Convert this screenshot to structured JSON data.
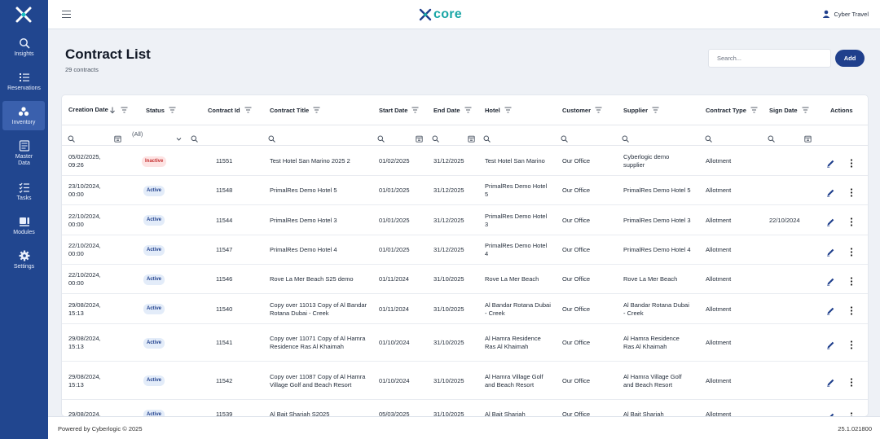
{
  "app": {
    "brand": "core",
    "user_name": "Cyber Travel"
  },
  "colors": {
    "sidebar": "#21468f",
    "sidebar_active": "#3a60ad",
    "accent": "#1f3f8c",
    "brand": "#19a6a6",
    "inactive": "#c53030"
  },
  "sidebar": {
    "items": [
      {
        "label": "Insights",
        "icon": "insights-icon"
      },
      {
        "label": "Reservations",
        "icon": "list-icon"
      },
      {
        "label": "Inventory",
        "icon": "inventory-icon",
        "active": true
      },
      {
        "label": "Master\nData",
        "icon": "master-data-icon"
      },
      {
        "label": "Tasks",
        "icon": "tasks-icon"
      },
      {
        "label": "Modules",
        "icon": "modules-icon"
      },
      {
        "label": "Settings",
        "icon": "gear-icon"
      }
    ]
  },
  "page": {
    "title": "Contract List",
    "count": "29 contracts",
    "search_placeholder": "Search...",
    "add_label": "Add"
  },
  "table": {
    "headers": {
      "creation_date": "Creation Date",
      "status": "Status",
      "contract_id": "Contract Id",
      "contract_title": "Contract Title",
      "start_date": "Start Date",
      "end_date": "End Date",
      "hotel": "Hotel",
      "customer": "Customer",
      "supplier": "Supplier",
      "contract_type": "Contract Type",
      "sign_date": "Sign Date",
      "actions": "Actions"
    },
    "status_filter": "(All)",
    "rows": [
      {
        "creation": "05/02/2025, 09:26",
        "status": "Inactive",
        "id": "11551",
        "title": "Test Hotel San Marino 2025 2",
        "start": "01/02/2025",
        "end": "31/12/2025",
        "hotel": "Test Hotel San Marino",
        "customer": "Our Office",
        "supplier": "Cyberlogic demo supplier",
        "type": "Allotment",
        "sign": ""
      },
      {
        "creation": "23/10/2024, 00:00",
        "status": "Active",
        "id": "11548",
        "title": "PrimalRes Demo Hotel 5",
        "start": "01/01/2025",
        "end": "31/12/2025",
        "hotel": "PrimalRes Demo Hotel 5",
        "customer": "Our Office",
        "supplier": "PrimalRes Demo Hotel 5",
        "type": "Allotment",
        "sign": ""
      },
      {
        "creation": "22/10/2024, 00:00",
        "status": "Active",
        "id": "11544",
        "title": "PrimalRes Demo Hotel 3",
        "start": "01/01/2025",
        "end": "31/12/2025",
        "hotel": "PrimalRes Demo Hotel 3",
        "customer": "Our Office",
        "supplier": "PrimalRes Demo Hotel 3",
        "type": "Allotment",
        "sign": "22/10/2024"
      },
      {
        "creation": "22/10/2024, 00:00",
        "status": "Active",
        "id": "11547",
        "title": "PrimalRes Demo Hotel 4",
        "start": "01/01/2025",
        "end": "31/12/2025",
        "hotel": "PrimalRes Demo Hotel 4",
        "customer": "Our Office",
        "supplier": "PrimalRes Demo Hotel 4",
        "type": "Allotment",
        "sign": ""
      },
      {
        "creation": "22/10/2024, 00:00",
        "status": "Active",
        "id": "11546",
        "title": "Rove La Mer Beach S25 demo",
        "start": "01/11/2024",
        "end": "31/10/2025",
        "hotel": "Rove La Mer Beach",
        "customer": "Our Office",
        "supplier": "Rove La Mer Beach",
        "type": "Allotment",
        "sign": ""
      },
      {
        "creation": "29/08/2024, 15:13",
        "status": "Active",
        "id": "11540",
        "title": "Copy over 11013 Copy of Al Bandar Rotana Dubai - Creek",
        "start": "01/11/2024",
        "end": "31/10/2025",
        "hotel": "Al Bandar Rotana Dubai - Creek",
        "customer": "Our Office",
        "supplier": "Al Bandar Rotana Dubai - Creek",
        "type": "Allotment",
        "sign": ""
      },
      {
        "creation": "29/08/2024, 15:13",
        "status": "Active",
        "id": "11541",
        "title": "Copy over 11071 Copy of Al Hamra Residence Ras Al Khaimah",
        "start": "01/10/2024",
        "end": "31/10/2025",
        "hotel": "Al Hamra Residence Ras Al Khaimah",
        "customer": "Our Office",
        "supplier": "Al Hamra Residence Ras Al Khaimah",
        "type": "Allotment",
        "sign": ""
      },
      {
        "creation": "29/08/2024, 15:13",
        "status": "Active",
        "id": "11542",
        "title": "Copy over 11087 Copy of Al Hamra Village Golf and Beach Resort",
        "start": "01/10/2024",
        "end": "31/10/2025",
        "hotel": "Al Hamra Village Golf and Beach Resort",
        "customer": "Our Office",
        "supplier": "Al Hamra Village Golf and Beach Resort",
        "type": "Allotment",
        "sign": ""
      },
      {
        "creation": "29/08/2024,",
        "status": "Active",
        "id": "11539",
        "title": "Al Bait Sharjah S2025",
        "start": "05/03/2025",
        "end": "31/10/2025",
        "hotel": "Al Bait Sharjah",
        "customer": "Our Office",
        "supplier": "Al Bait Sharjah",
        "type": "Allotment",
        "sign": ""
      }
    ]
  },
  "footer": {
    "powered": "Powered by Cyberlogic © 2025",
    "version": "25.1.021800"
  }
}
